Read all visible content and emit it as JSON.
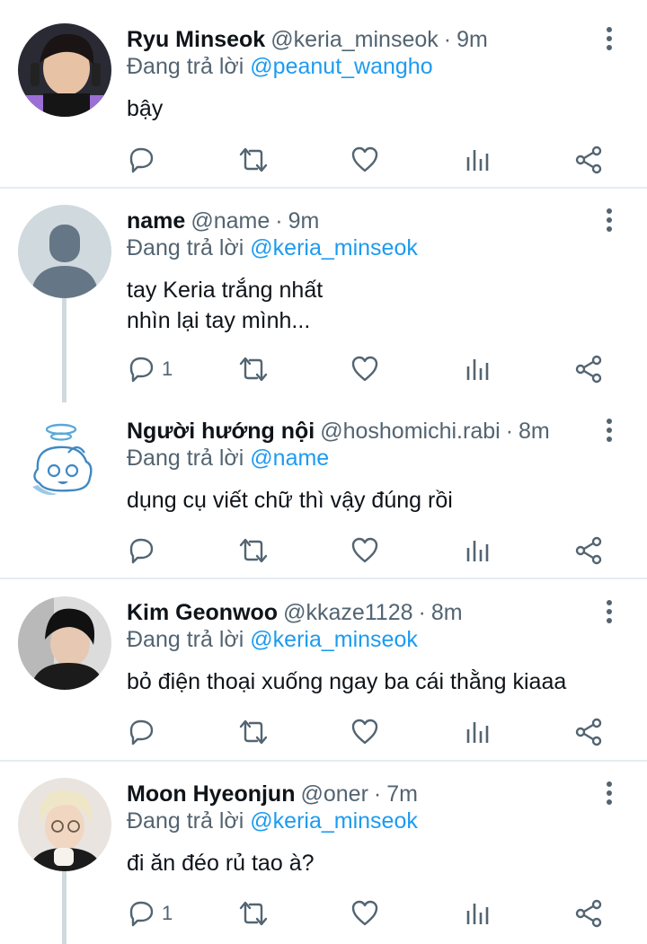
{
  "replying_prefix": "Đang trả lời",
  "tweets": [
    {
      "name": "Ryu Minseok",
      "handle": "@keria_minseok",
      "dot": "·",
      "time": "9m",
      "reply_to": "@peanut_wangho",
      "text": "bậy",
      "reply_count": ""
    },
    {
      "name": "name",
      "handle": "@name",
      "dot": "·",
      "time": "9m",
      "reply_to": "@keria_minseok",
      "text": "tay Keria trắng nhất\nnhìn lại tay mình...",
      "reply_count": "1"
    },
    {
      "name": "Người hướng nội",
      "handle": "@hoshomichi.rabi",
      "dot": "·",
      "time": "8m",
      "reply_to": "@name",
      "text": "dụng cụ viết chữ thì vậy đúng rồi",
      "reply_count": ""
    },
    {
      "name": "Kim Geonwoo",
      "handle": "@kkaze1128",
      "dot": "·",
      "time": "8m",
      "reply_to": "@keria_minseok",
      "text": "bỏ điện thoại xuống ngay ba cái thằng kiaaa",
      "reply_count": ""
    },
    {
      "name": "Moon Hyeonjun",
      "handle": "@oner",
      "dot": "·",
      "time": "7m",
      "reply_to": "@keria_minseok",
      "text": "đi ăn đéo rủ tao à?",
      "reply_count": "1"
    }
  ],
  "colors": {
    "mention": "#1d9bf0",
    "muted": "#536471",
    "thread_line": "#cfd9de"
  }
}
